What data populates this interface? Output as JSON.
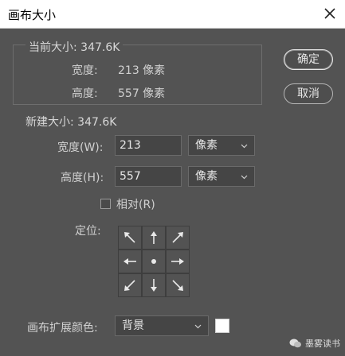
{
  "window": {
    "title": "画布大小"
  },
  "current": {
    "legend": "当前大小: 347.6K",
    "width_label": "宽度:",
    "width_value": "213 像素",
    "height_label": "高度:",
    "height_value": "557 像素"
  },
  "new_size": {
    "legend": "新建大小: 347.6K",
    "width_label": "宽度(W):",
    "width_value": "213",
    "width_unit": "像素",
    "height_label": "高度(H):",
    "height_value": "557",
    "height_unit": "像素",
    "relative_label": "相对(R)",
    "relative_checked": false,
    "anchor_label": "定位:"
  },
  "buttons": {
    "ok": "确定",
    "cancel": "取消"
  },
  "extension": {
    "label": "画布扩展颜色:",
    "value": "背景",
    "swatch_color": "#ffffff"
  },
  "watermark": {
    "text": "墨雾读书"
  },
  "icons": {
    "close": "close-icon",
    "anchor": [
      "arrow-up-left-icon",
      "arrow-up-icon",
      "arrow-up-right-icon",
      "arrow-left-icon",
      "center-dot-icon",
      "arrow-right-icon",
      "arrow-down-left-icon",
      "arrow-down-icon",
      "arrow-down-right-icon"
    ]
  }
}
